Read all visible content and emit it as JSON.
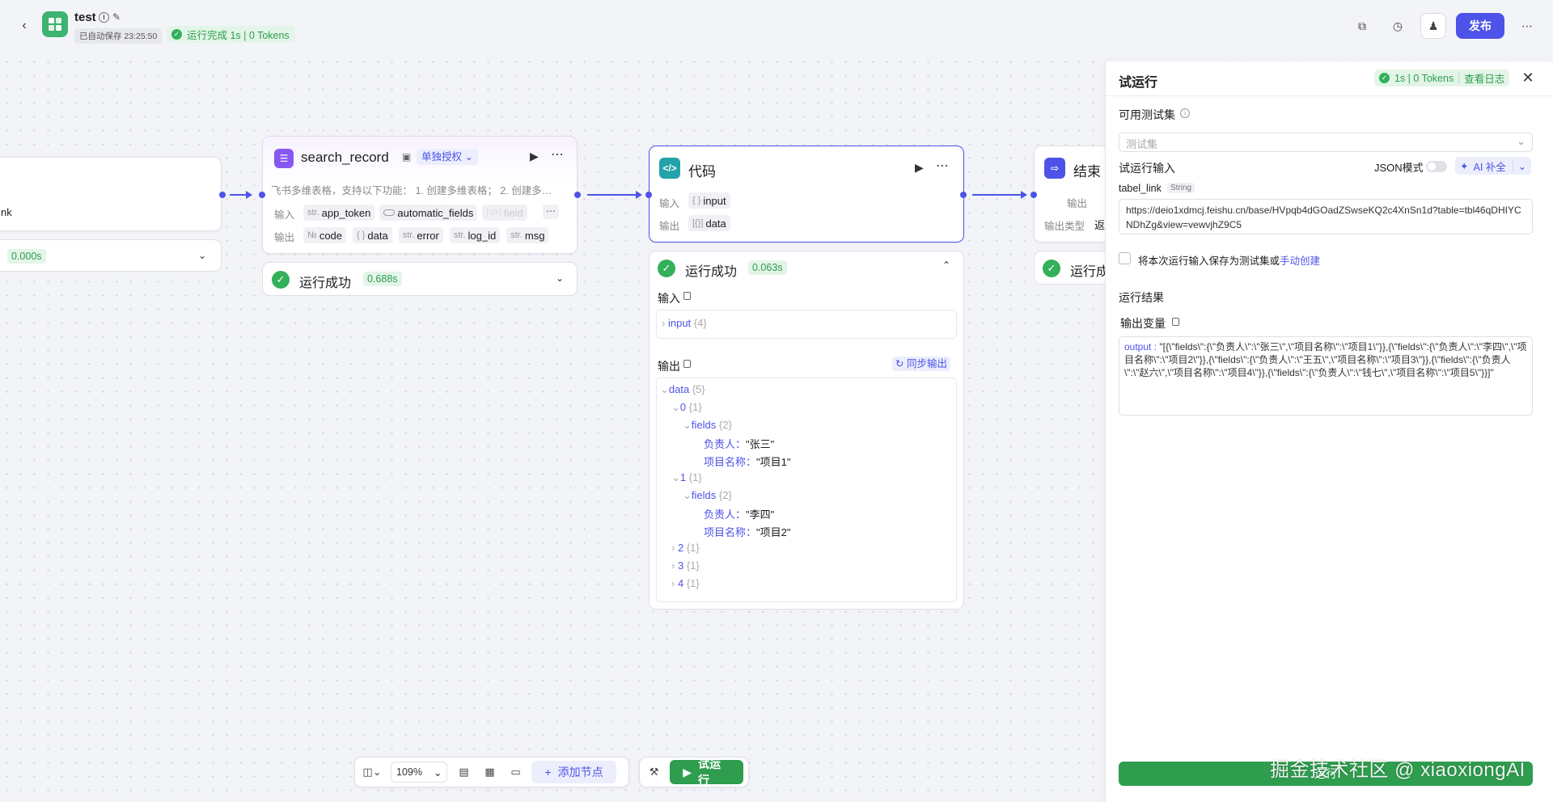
{
  "header": {
    "title": "test",
    "autosave": "已自动保存 23:25:50",
    "run_status": "运行完成 1s | 0 Tokens",
    "publish_label": "发布"
  },
  "left_node": {
    "field_suffix": "nk",
    "time": "0.000s"
  },
  "search_node": {
    "title": "search_record",
    "auth_label": "单独授权",
    "description": "飞书多维表格，支持以下功能： 1. 创建多维表格； 2. 创建多…",
    "input_label": "输入",
    "output_label": "输出",
    "inputs": [
      {
        "type": "str.",
        "name": "app_token"
      },
      {
        "type": "",
        "name": "automatic_fields"
      },
      {
        "type": "[str]",
        "name": "field"
      }
    ],
    "outputs": [
      {
        "type": "№",
        "name": "code"
      },
      {
        "type": "{ }",
        "name": "data"
      },
      {
        "type": "str.",
        "name": "error"
      },
      {
        "type": "str.",
        "name": "log_id"
      },
      {
        "type": "str.",
        "name": "msg"
      }
    ],
    "status": "运行成功",
    "time": "0.688s"
  },
  "code_node": {
    "title": "代码",
    "input_label": "输入",
    "output_label": "输出",
    "input_type": "{ }",
    "input_name": "input",
    "output_type": "[{}]",
    "output_name": "data",
    "status": "运行成功",
    "time": "0.063s",
    "section_input": "输入",
    "section_output": "输出",
    "sync_output": "同步输出",
    "input_tree": {
      "key": "input",
      "count": "{4}"
    },
    "tree": {
      "data_key": "data",
      "data_count": "{5}",
      "items": [
        {
          "idx": "0",
          "count": "{1}",
          "fields": "fields",
          "fields_count": "{2}",
          "owner_key": "负责人：",
          "owner": "\"张三\"",
          "project_key": "项目名称：",
          "project": "\"项目1\""
        },
        {
          "idx": "1",
          "count": "{1}",
          "fields": "fields",
          "fields_count": "{2}",
          "owner_key": "负责人：",
          "owner": "\"李四\"",
          "project_key": "项目名称：",
          "project": "\"项目2\""
        }
      ],
      "collapsed": [
        {
          "idx": "2",
          "count": "{1}"
        },
        {
          "idx": "3",
          "count": "{1}"
        },
        {
          "idx": "4",
          "count": "{1}"
        }
      ]
    }
  },
  "end_node": {
    "title": "结束",
    "output_label": "输出",
    "output_type_label": "输出类型",
    "output_type_value_partial": "返",
    "status_partial": "运行成"
  },
  "panel": {
    "title": "试运行",
    "badge_stats": "1s | 0 Tokens",
    "badge_log": "查看日志",
    "testset_label": "可用测试集",
    "testset_placeholder": "测试集",
    "input_label": "试运行输入",
    "json_mode": "JSON模式",
    "ai_fill": "AI 补全",
    "param_name": "tabel_link",
    "param_type": "String",
    "param_value": "https://deio1xdmcj.feishu.cn/base/HVpqb4dGOadZSwseKQ2c4XnSn1d?table=tbl46qDHIYCNDhZg&view=vewvjhZ9C5",
    "save_text": "将本次运行输入保存为测试集或",
    "save_link": "手动创建",
    "result_label": "运行结果",
    "output_var_label": "输出变量",
    "output_key": "output :",
    "output_value": "\"[{\\\"fields\\\":{\\\"负责人\\\":\\\"张三\\\",\\\"项目名称\\\":\\\"项目1\\\"}},{\\\"fields\\\":{\\\"负责人\\\":\\\"李四\\\",\\\"项目名称\\\":\\\"项目2\\\"}},{\\\"fields\\\":{\\\"负责人\\\":\\\"王五\\\",\\\"项目名称\\\":\\\"项目3\\\"}},{\\\"fields\\\":{\\\"负责人\\\":\\\"赵六\\\",\\\"项目名称\\\":\\\"项目4\\\"}},{\\\"fields\\\":{\\\"负责人\\\":\\\"钱七\\\",\\\"项目名称\\\":\\\"项目5\\\"}}]\"",
    "bottom_button": "运行"
  },
  "watermark": "掘金技术社区 @ xiaoxiongAI",
  "toolbar": {
    "zoom": "109%",
    "add_node": "添加节点",
    "run": "试运行"
  },
  "colors": {
    "primary": "#4d53e8",
    "success": "#2e9d4e",
    "success_bg": "#e3f5e8",
    "canvas": "#f3f4f8"
  }
}
